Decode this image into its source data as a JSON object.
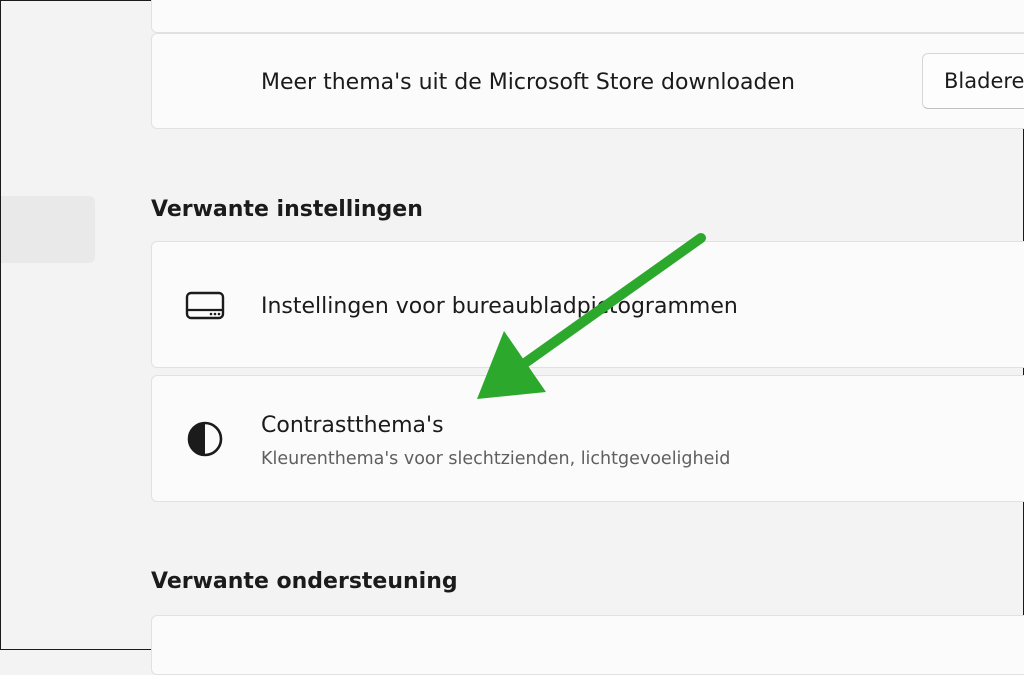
{
  "store_card": {
    "title": "Meer thema's uit de Microsoft Store downloaden",
    "button_label": "Bladere"
  },
  "related_settings": {
    "heading": "Verwante instellingen",
    "items": [
      {
        "title": "Instellingen voor bureaubladpictogrammen",
        "icon": "desktop-icon"
      },
      {
        "title": "Contrastthema's",
        "subtitle": "Kleurenthema's voor slechtzienden, lichtgevoeligheid",
        "icon": "contrast-icon"
      }
    ]
  },
  "related_support": {
    "heading": "Verwante ondersteuning"
  },
  "annotation": {
    "arrow_color": "#2ca82c"
  }
}
